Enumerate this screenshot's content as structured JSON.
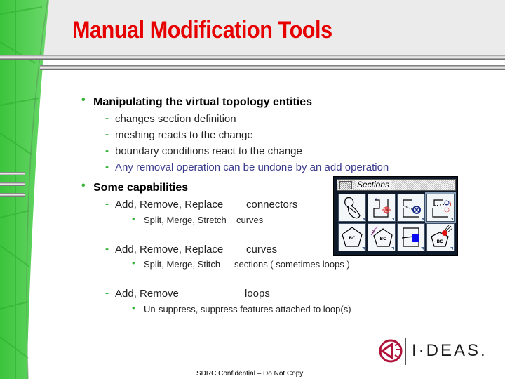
{
  "slide": {
    "title": "Manual Modification Tools",
    "footer": "SDRC Confidential – Do Not Copy"
  },
  "bullets": [
    {
      "text": "Manipulating the virtual topology entities",
      "sub": [
        {
          "text": "changes section definition"
        },
        {
          "text": "meshing reacts to the change"
        },
        {
          "text": "boundary conditions react to the change"
        },
        {
          "text": "Any removal operation can be undone by an add operation",
          "emphasis": true
        }
      ]
    },
    {
      "text": "Some capabilities",
      "sub": [
        {
          "action": "Add, Remove, Replace",
          "target": "connectors",
          "detail": {
            "action": "Split, Merge, Stretch",
            "target": "curves"
          }
        },
        {
          "action": "Add, Remove, Replace",
          "target": "curves",
          "detail": {
            "action": "Split, Merge, Stitch",
            "target": "sections ( sometimes loops )"
          }
        },
        {
          "action": "Add, Remove",
          "target": "loops",
          "detail": {
            "action": "Un-suppress, suppress features attached to loop(s)",
            "target": ""
          }
        }
      ]
    }
  ],
  "palette": {
    "title": "Sections",
    "tools": [
      {
        "icon": "section-shape-icon"
      },
      {
        "icon": "add-connector-icon"
      },
      {
        "icon": "remove-connector-icon"
      },
      {
        "icon": "replace-connector-icon",
        "selected": true
      },
      {
        "icon": "boundary-condition-section-icon"
      },
      {
        "icon": "curve-boundary-condition-icon"
      },
      {
        "icon": "loop-fill-icon"
      },
      {
        "icon": "suppress-feature-icon"
      }
    ]
  },
  "logo": {
    "brand": "I·DEAS.",
    "colors": {
      "mark": "#b0123a",
      "text": "#1a1a1a"
    }
  },
  "colors": {
    "title": "#e60000",
    "bullet": "#33b233",
    "emphasis_text": "#3a3a8c",
    "sidebar_green": "#4fcf4f"
  }
}
